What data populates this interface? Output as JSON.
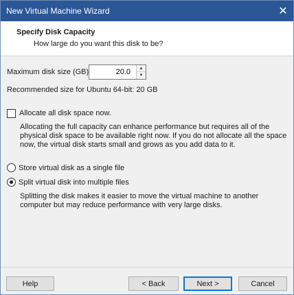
{
  "window": {
    "title": "New Virtual Machine Wizard",
    "close_glyph": "✕"
  },
  "header": {
    "title": "Specify Disk Capacity",
    "subtitle": "How large do you want this disk to be?"
  },
  "disk": {
    "label": "Maximum disk size (GB):",
    "value": "20.0",
    "recommended": "Recommended size for Ubuntu 64-bit: 20 GB"
  },
  "allocate": {
    "label": "Allocate all disk space now.",
    "checked": false,
    "description": "Allocating the full capacity can enhance performance but requires all of the physical disk space to be available right now. If you do not allocate all the space now, the virtual disk starts small and grows as you add data to it."
  },
  "storage": {
    "single_label": "Store virtual disk as a single file",
    "multiple_label": "Split virtual disk into multiple files",
    "selected": "multiple",
    "multiple_description": "Splitting the disk makes it easier to move the virtual machine to another computer but may reduce performance with very large disks."
  },
  "buttons": {
    "help": "Help",
    "back": "< Back",
    "next": "Next >",
    "cancel": "Cancel"
  },
  "colors": {
    "titlebar": "#2b5797",
    "accent": "#0078d7"
  },
  "icons": [
    "close-icon",
    "spin-up-icon",
    "spin-down-icon"
  ]
}
